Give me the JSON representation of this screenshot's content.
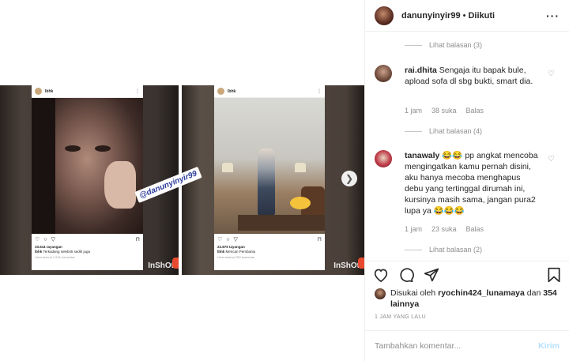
{
  "post": {
    "panels": [
      {
        "username": "lbhk",
        "views": "33.641 tayangan",
        "caption_user": "lbhk",
        "caption": "Terkadang selebriti sedih juga",
        "view_all": "Lihat semua 1.541 komentar",
        "watermark": "InShOt"
      },
      {
        "username": "lbhk",
        "views": "22.875 tayangan",
        "caption_user": "lbhk",
        "caption": "Mencari Pembantu",
        "view_all": "Lihat semua 259 komentar",
        "watermark": "InShOt"
      }
    ],
    "tag": "@danunyinyir99"
  },
  "side": {
    "header": {
      "username": "danunyinyir99",
      "separator": "•",
      "follow_status": "Diikuti",
      "more": "···"
    },
    "comments": [
      {
        "type": "replies",
        "label": "Lihat balasan (3)"
      },
      {
        "type": "comment",
        "username": "rai.dhita",
        "text": "Sengaja itu bapak bule, apload sofa dl sbg bukti, smart dia.",
        "time": "1 jam",
        "likes": "38 suka",
        "reply": "Balas"
      },
      {
        "type": "replies",
        "label": "Lihat balasan (4)"
      },
      {
        "type": "comment",
        "username": "tanawaly",
        "text": "😂😂 pp angkat mencoba mengingatkan kamu pernah disini, aku hanya mecoba menghapus debu yang tertinggal dirumah ini, kursinya masih sama, jangan pura2 lupa ya 😂😂😂",
        "time": "1 jam",
        "likes": "23 suka",
        "reply": "Balas"
      },
      {
        "type": "replies",
        "label": "Lihat balasan (2)"
      }
    ],
    "likes": {
      "prefix": "Disukai oleh",
      "user": "ryochin424_lunamaya",
      "middle": "dan",
      "others": "354 lainnya"
    },
    "time_ago": "1 JAM YANG LALU",
    "add_comment": {
      "placeholder": "Tambahkan komentar...",
      "post_label": "Kirim"
    }
  }
}
